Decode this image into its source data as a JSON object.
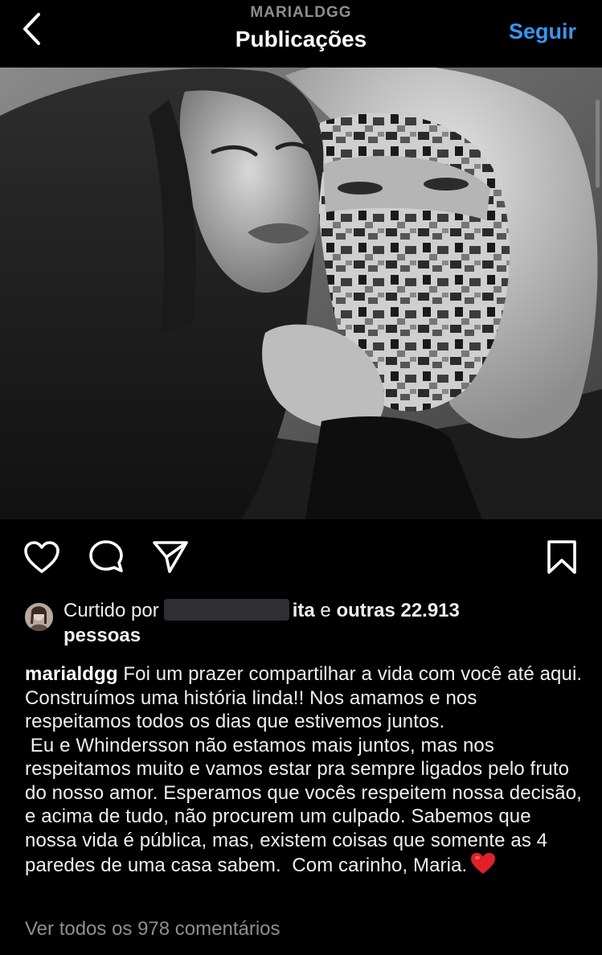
{
  "header": {
    "username": "MARIALDGG",
    "title": "Publicações",
    "follow_label": "Seguir",
    "back_icon": "chevron-left-icon"
  },
  "post": {
    "photo_description_icon": "photo",
    "actions": {
      "like_icon": "heart-icon",
      "comment_icon": "comment-icon",
      "share_icon": "paper-plane-icon",
      "save_icon": "bookmark-icon"
    },
    "likes": {
      "prefix": "Curtido por",
      "user_suffix": "ita",
      "conjunction": "e",
      "others": "outras 22.913",
      "others_unit": "pessoas"
    },
    "caption": {
      "username": "marialdgg",
      "text": " Foi um prazer compartilhar a vida com você até aqui. Construímos uma história linda!! Nos amamos e nos respeitamos todos os dias que estivemos juntos.\n Eu e Whindersson não estamos mais juntos, mas nos respeitamos muito e vamos estar pra sempre ligados pelo fruto do nosso amor. Esperamos que vocês respeitem nossa decisão, e acima de tudo, não procurem um culpado. Sabemos que nossa vida é pública, mas, existem coisas que somente as 4 paredes de uma casa sabem.  Com carinho, Maria.",
      "emoji_icon": "red-heart-icon"
    },
    "view_comments": "Ver todos os 978 comentários"
  },
  "colors": {
    "background": "#000000",
    "link_blue": "#3897f0",
    "muted_text": "#8e8e8e",
    "heart_red": "#e0202a"
  }
}
